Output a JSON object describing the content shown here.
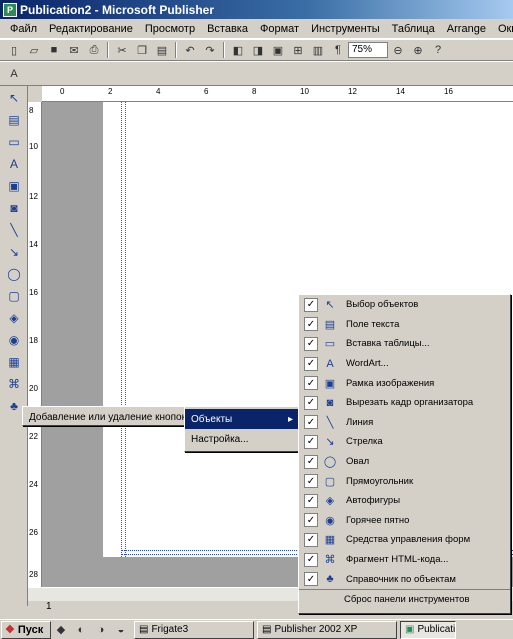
{
  "window": {
    "title": "Publication2 - Microsoft Publisher"
  },
  "menubar": [
    "Файл",
    "Редактирование",
    "Просмотр",
    "Вставка",
    "Формат",
    "Инструменты",
    "Таблица",
    "Arrange",
    "Окно"
  ],
  "toolbar": {
    "zoom": "75%"
  },
  "rulers": {
    "horizontal_ticks": [
      "0",
      "2",
      "4",
      "6",
      "8",
      "10",
      "12",
      "14",
      "16"
    ],
    "vertical_ticks": [
      "8",
      "10",
      "12",
      "14",
      "16",
      "18",
      "20",
      "22",
      "24",
      "26",
      "28"
    ]
  },
  "context_menu": {
    "root": "Добавление или удаление кнопок",
    "submenu": [
      "Объекты",
      "Настройка..."
    ],
    "items": [
      {
        "label": "Выбор объектов",
        "icon": "pointer-icon"
      },
      {
        "label": "Поле текста",
        "icon": "text-box-icon"
      },
      {
        "label": "Вставка таблицы...",
        "icon": "table-icon"
      },
      {
        "label": "WordArt...",
        "icon": "wordart-icon"
      },
      {
        "label": "Рамка изображения",
        "icon": "picture-frame-icon"
      },
      {
        "label": "Вырезать кадр организатора",
        "icon": "clip-organizer-icon"
      },
      {
        "label": "Линия",
        "icon": "line-icon"
      },
      {
        "label": "Стрелка",
        "icon": "arrow-icon"
      },
      {
        "label": "Овал",
        "icon": "oval-icon"
      },
      {
        "label": "Прямоугольник",
        "icon": "rectangle-icon"
      },
      {
        "label": "Автофигуры",
        "icon": "autoshapes-icon"
      },
      {
        "label": "Горячее пятно",
        "icon": "hotspot-icon"
      },
      {
        "label": "Средства управления форм",
        "icon": "form-controls-icon"
      },
      {
        "label": "Фрагмент HTML-кода...",
        "icon": "html-fragment-icon"
      },
      {
        "label": "Справочник по объектам",
        "icon": "design-gallery-icon"
      }
    ],
    "reset": "Сброс панели инструментов"
  },
  "statusbar": {
    "page": "1"
  },
  "taskbar": {
    "start": "Пуск",
    "tasks": [
      "Frigate3",
      "Publisher 2002 XP",
      "Publication"
    ]
  }
}
